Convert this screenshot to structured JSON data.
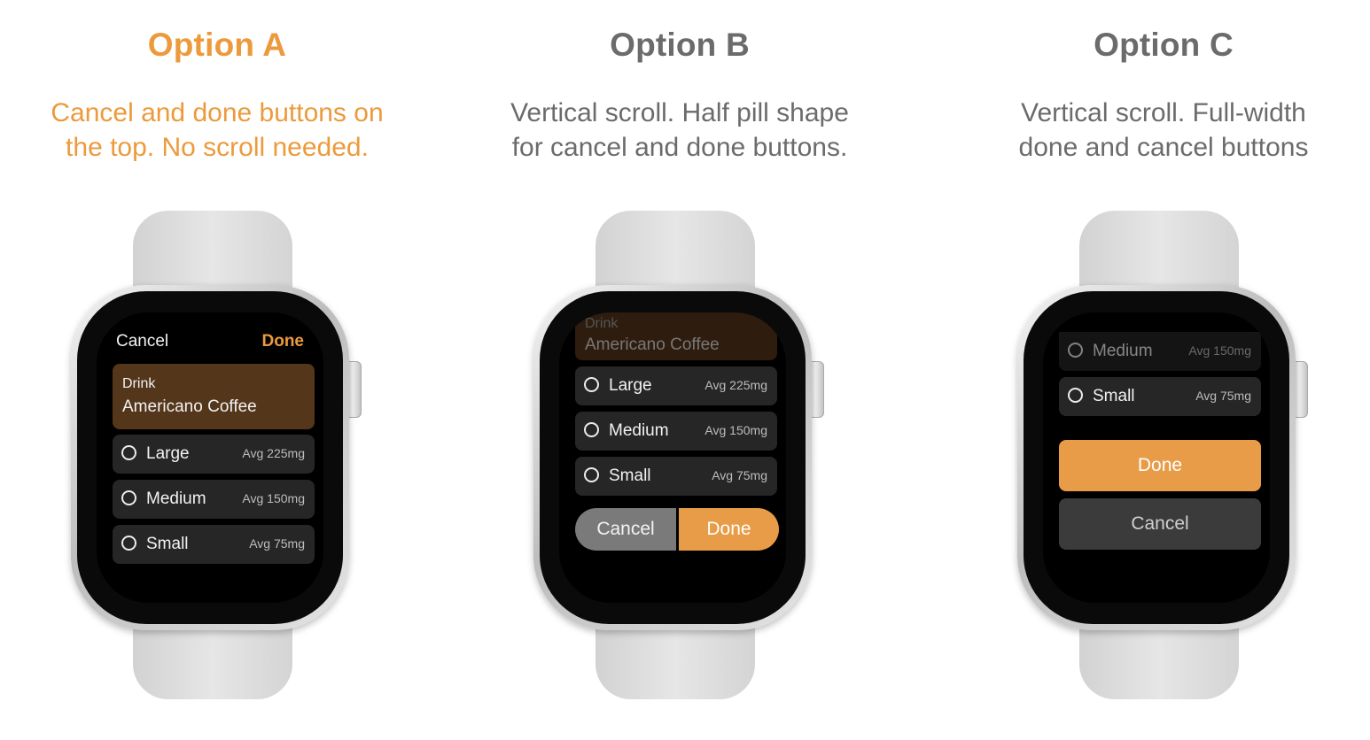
{
  "colors": {
    "accent": "#ec9a3c",
    "muted_text": "#6b6b6b",
    "card_brown": "#54361a",
    "row_gray": "#262626",
    "done_orange": "#e89c48"
  },
  "options": [
    {
      "title": "Option A",
      "description_line1": "Cancel and done buttons on",
      "description_line2": "the top. No scroll needed.",
      "screen": {
        "cancel": "Cancel",
        "done": "Done",
        "drink_label": "Drink",
        "drink_value": "Americano Coffee",
        "sizes": [
          {
            "label": "Large",
            "avg": "Avg 225mg"
          },
          {
            "label": "Medium",
            "avg": "Avg 150mg"
          },
          {
            "label": "Small",
            "avg": "Avg 75mg"
          }
        ]
      }
    },
    {
      "title": "Option B",
      "description_line1": "Vertical scroll. Half pill shape",
      "description_line2": "for cancel and done buttons.",
      "screen": {
        "drink_label": "Drink",
        "drink_value": "Americano Coffee",
        "sizes": [
          {
            "label": "Large",
            "avg": "Avg 225mg"
          },
          {
            "label": "Medium",
            "avg": "Avg 150mg"
          },
          {
            "label": "Small",
            "avg": "Avg 75mg"
          }
        ],
        "cancel": "Cancel",
        "done": "Done"
      }
    },
    {
      "title": "Option C",
      "description_line1": "Vertical scroll. Full-width",
      "description_line2": "done and cancel buttons",
      "screen": {
        "sizes": [
          {
            "label": "Medium",
            "avg": "Avg 150mg"
          },
          {
            "label": "Small",
            "avg": "Avg 75mg"
          }
        ],
        "done": "Done",
        "cancel": "Cancel"
      }
    }
  ]
}
